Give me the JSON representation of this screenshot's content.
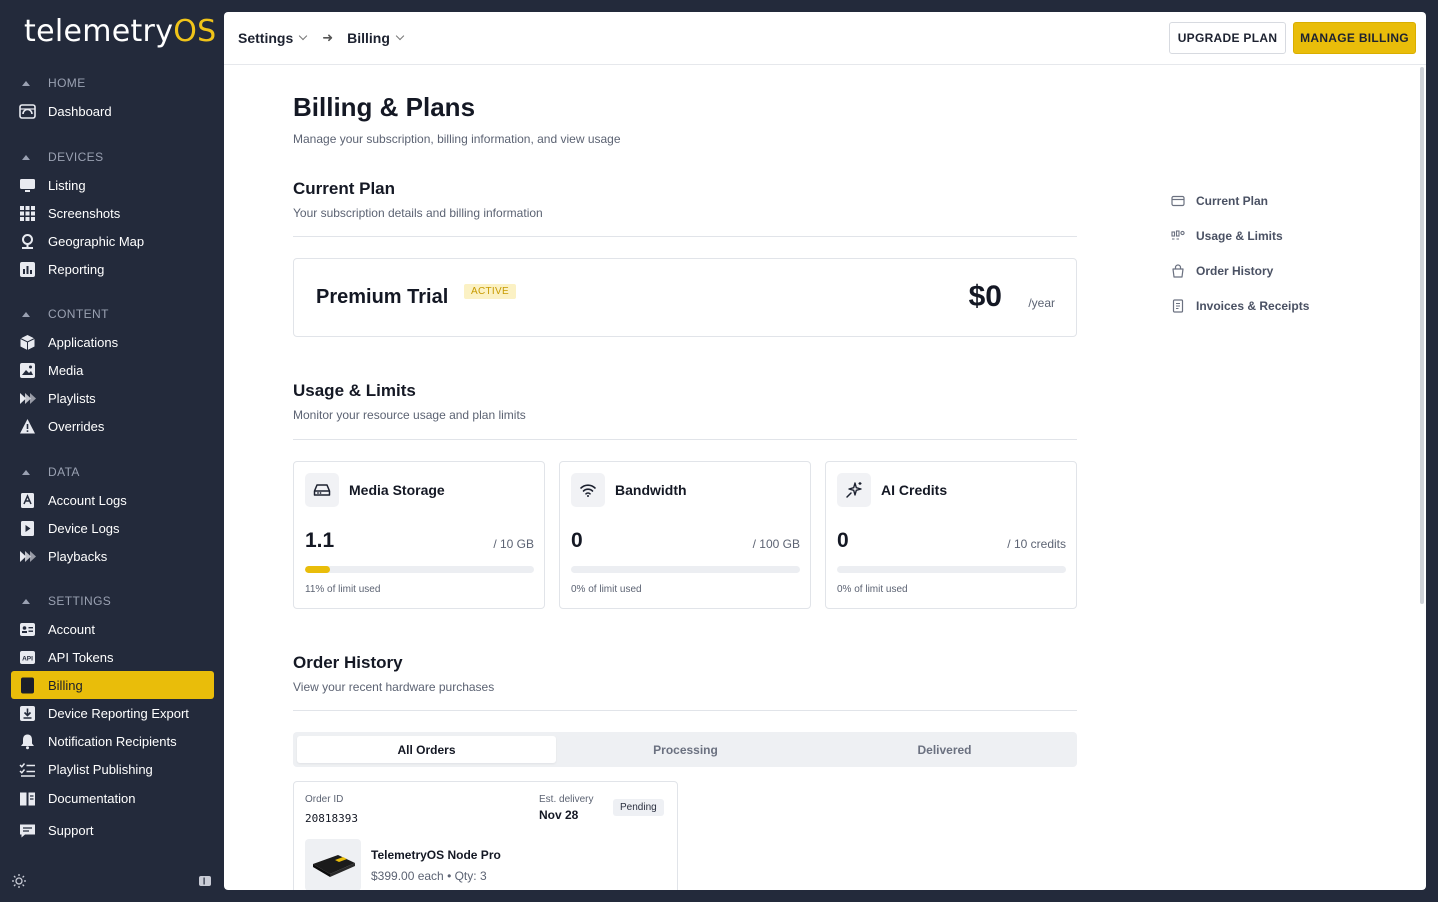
{
  "app": {
    "logo_main": "telemetry",
    "logo_accent": "OS"
  },
  "sidebar": {
    "sections": [
      {
        "title": "HOME",
        "items": [
          {
            "label": "Dashboard",
            "icon": "dashboard-icon"
          }
        ]
      },
      {
        "title": "DEVICES",
        "items": [
          {
            "label": "Listing",
            "icon": "monitor-icon"
          },
          {
            "label": "Screenshots",
            "icon": "grid-icon"
          },
          {
            "label": "Geographic Map",
            "icon": "map-pin-icon"
          },
          {
            "label": "Reporting",
            "icon": "bar-chart-icon"
          }
        ]
      },
      {
        "title": "CONTENT",
        "items": [
          {
            "label": "Applications",
            "icon": "cube-icon"
          },
          {
            "label": "Media",
            "icon": "image-icon"
          },
          {
            "label": "Playlists",
            "icon": "play-stack-icon"
          },
          {
            "label": "Overrides",
            "icon": "warning-icon"
          }
        ]
      },
      {
        "title": "DATA",
        "items": [
          {
            "label": "Account Logs",
            "icon": "account-log-icon"
          },
          {
            "label": "Device Logs",
            "icon": "device-log-icon"
          },
          {
            "label": "Playbacks",
            "icon": "play-stack-icon"
          }
        ]
      },
      {
        "title": "SETTINGS",
        "items": [
          {
            "label": "Account",
            "icon": "id-card-icon"
          },
          {
            "label": "API Tokens",
            "icon": "api-icon"
          },
          {
            "label": "Billing",
            "icon": "receipt-icon",
            "active": true
          },
          {
            "label": "Device Reporting Export",
            "icon": "download-icon"
          },
          {
            "label": "Notification Recipients",
            "icon": "bell-icon"
          },
          {
            "label": "Playlist Publishing",
            "icon": "list-check-icon"
          }
        ]
      }
    ],
    "footer_items": [
      {
        "label": "Documentation",
        "icon": "book-icon"
      },
      {
        "label": "Support",
        "icon": "chat-icon"
      }
    ]
  },
  "topbar": {
    "breadcrumb": [
      "Settings",
      "Billing"
    ],
    "upgrade_label": "UPGRADE PLAN",
    "manage_label": "MANAGE BILLING"
  },
  "page": {
    "title": "Billing & Plans",
    "subtitle": "Manage your subscription, billing information, and view usage"
  },
  "current_plan": {
    "heading": "Current Plan",
    "subheading": "Your subscription details and billing information",
    "name": "Premium Trial",
    "status": "ACTIVE",
    "price": "$0",
    "period": "/year"
  },
  "usage": {
    "heading": "Usage & Limits",
    "subheading": "Monitor your resource usage and plan limits",
    "cards": [
      {
        "title": "Media Storage",
        "icon": "hard-drive-icon",
        "value": "1.1",
        "limit": "/ 10 GB",
        "fraction": 0.11,
        "pct_text": "11% of limit used"
      },
      {
        "title": "Bandwidth",
        "icon": "wifi-icon",
        "value": "0",
        "limit": "/ 100 GB",
        "fraction": 0,
        "pct_text": "0% of limit used"
      },
      {
        "title": "AI Credits",
        "icon": "sparkles-icon",
        "value": "0",
        "limit": "/ 10 credits",
        "fraction": 0,
        "pct_text": "0% of limit used"
      }
    ]
  },
  "orders": {
    "heading": "Order History",
    "subheading": "View your recent hardware purchases",
    "tabs": [
      "All Orders",
      "Processing",
      "Delivered"
    ],
    "order": {
      "id_label": "Order ID",
      "id": "20818393",
      "delivery_label": "Est. delivery",
      "delivery": "Nov 28",
      "status": "Pending",
      "product": "TelemetryOS Node Pro",
      "meta": "$399.00 each  •  Qty: 3"
    }
  },
  "toc": [
    {
      "label": "Current Plan",
      "icon": "credit-card-icon"
    },
    {
      "label": "Usage & Limits",
      "icon": "usage-icon"
    },
    {
      "label": "Order History",
      "icon": "shopping-bag-icon"
    },
    {
      "label": "Invoices & Receipts",
      "icon": "invoice-icon"
    }
  ],
  "colors": {
    "accent": "#e9bd0a",
    "sidebar_bg": "#232a3b"
  }
}
